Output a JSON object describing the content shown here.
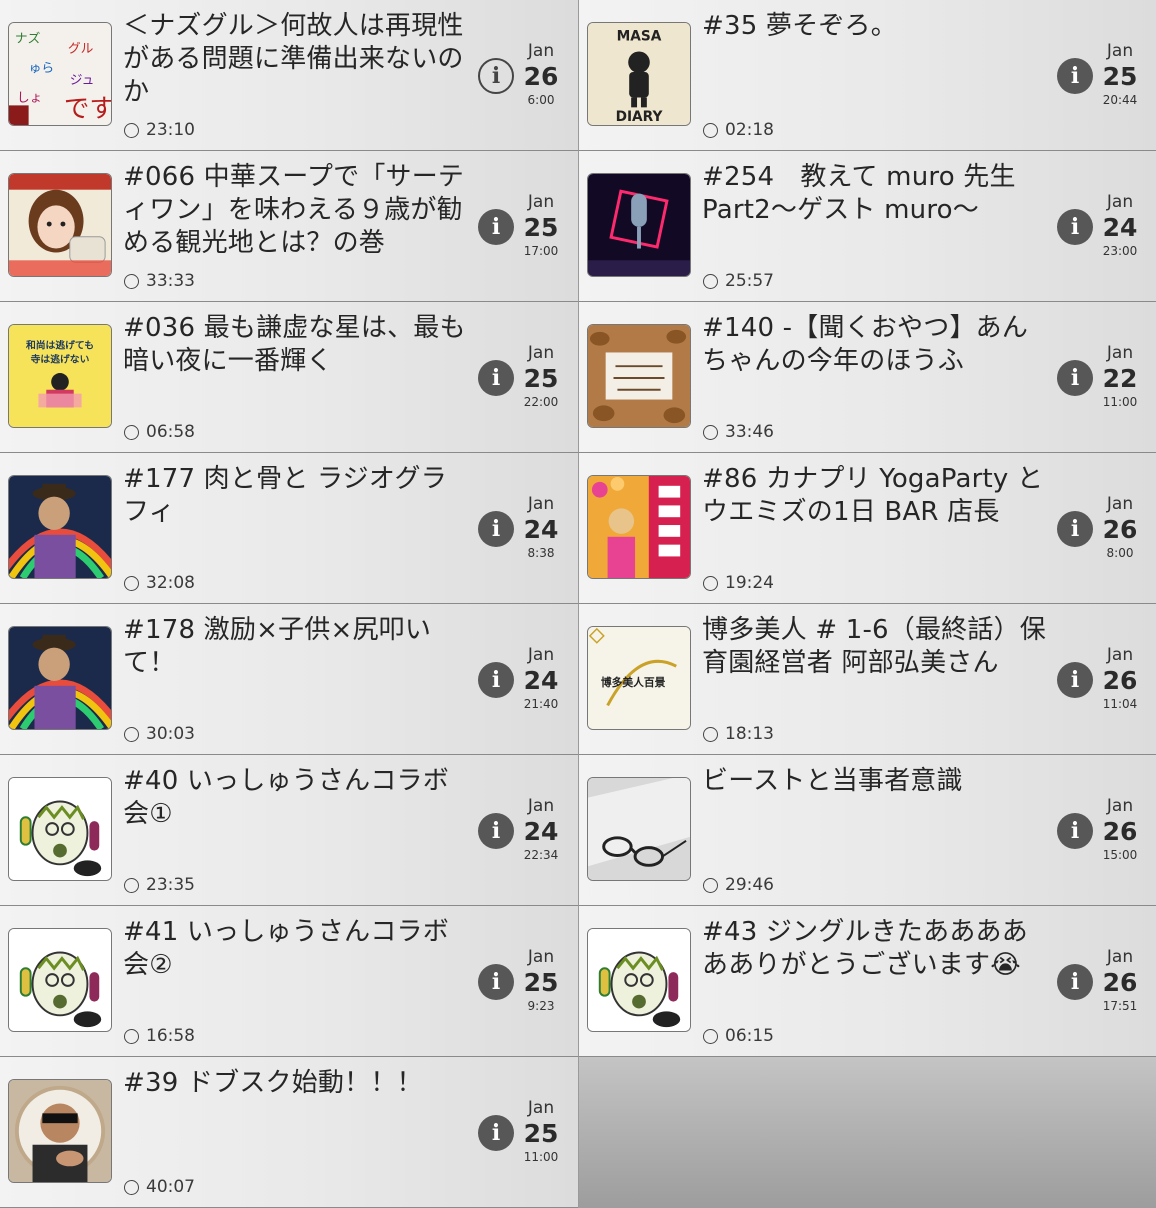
{
  "episodes": [
    {
      "title": "＜ナズグル＞何故人は再現性がある問題に準備出来ないのか",
      "duration": "23:10",
      "month": "Jan",
      "day": "26",
      "time": "6:00",
      "thumb": "text-art-icon",
      "info_style": "outline"
    },
    {
      "title": "#35 夢そぞろ。",
      "duration": "02:18",
      "month": "Jan",
      "day": "25",
      "time": "20:44",
      "thumb": "masa-diary-icon",
      "info_style": "filled",
      "thumb_text": {
        "top": "MASA",
        "bottom": "DIARY"
      }
    },
    {
      "title": "#066 中華スープで「サーティワン」を味わえる９歳が勧める観光地とは？の巻",
      "duration": "33:33",
      "month": "Jan",
      "day": "25",
      "time": "17:00",
      "thumb": "girl-illustration-icon",
      "info_style": "filled"
    },
    {
      "title": "#254　教えて muro 先生 Part2～ゲスト muro～",
      "duration": "25:57",
      "month": "Jan",
      "day": "24",
      "time": "23:00",
      "thumb": "neon-microphone-icon",
      "info_style": "filled"
    },
    {
      "title": "#036 最も謙虚な星は、最も暗い夜に一番輝く",
      "duration": "06:58",
      "month": "Jan",
      "day": "25",
      "time": "22:00",
      "thumb": "yellow-book-icon",
      "info_style": "filled",
      "thumb_text": {
        "line1": "和尚は逃げても",
        "line2": "寺は逃げない"
      }
    },
    {
      "title": "#140 -【聞くおやつ】あんちゃんの今年のほうふ",
      "duration": "33:46",
      "month": "Jan",
      "day": "22",
      "time": "11:00",
      "thumb": "nuts-icon",
      "info_style": "filled"
    },
    {
      "title": "#177 肉と骨と ラジオグラフィ",
      "duration": "32:08",
      "month": "Jan",
      "day": "24",
      "time": "8:38",
      "thumb": "robot-rainbow-icon",
      "info_style": "filled"
    },
    {
      "title": "#86 カナプリ YogaParty とウエミズの1日 BAR 店長",
      "duration": "19:24",
      "month": "Jan",
      "day": "26",
      "time": "8:00",
      "thumb": "woman-flowers-icon",
      "info_style": "filled"
    },
    {
      "title": "#178 激励×子供×尻叩いて！",
      "duration": "30:03",
      "month": "Jan",
      "day": "24",
      "time": "21:40",
      "thumb": "robot-rainbow-icon",
      "info_style": "filled"
    },
    {
      "title": "博多美人 # 1-6（最終話）保育園経営者 阿部弘美さん",
      "duration": "18:13",
      "month": "Jan",
      "day": "26",
      "time": "11:04",
      "thumb": "hakata-bijin-icon",
      "info_style": "filled",
      "thumb_text": {
        "line1": "博多美人百景"
      }
    },
    {
      "title": "#40 いっしゅうさんコラボ会①",
      "duration": "23:35",
      "month": "Jan",
      "day": "24",
      "time": "22:34",
      "thumb": "egg-character-icon",
      "info_style": "filled"
    },
    {
      "title": "ビーストと当事者意識",
      "duration": "29:46",
      "month": "Jan",
      "day": "26",
      "time": "15:00",
      "thumb": "sunglasses-photo-icon",
      "info_style": "filled"
    },
    {
      "title": "#41 いっしゅうさんコラボ会②",
      "duration": "16:58",
      "month": "Jan",
      "day": "25",
      "time": "9:23",
      "thumb": "egg-character-icon",
      "info_style": "filled"
    },
    {
      "title": "#43 ジングルきたあああああありがとうございます😭",
      "duration": "06:15",
      "month": "Jan",
      "day": "26",
      "time": "17:51",
      "thumb": "egg-character-icon",
      "info_style": "filled"
    },
    {
      "title": "#39 ドブスク始動！！！",
      "duration": "40:07",
      "month": "Jan",
      "day": "25",
      "time": "11:00",
      "thumb": "man-portrait-icon",
      "info_style": "filled"
    }
  ],
  "colors": {
    "cell_bg": "#efefef",
    "empty_bg": "#a8a8a8",
    "info_bg": "#575757",
    "divider": "#8a8a8a"
  }
}
